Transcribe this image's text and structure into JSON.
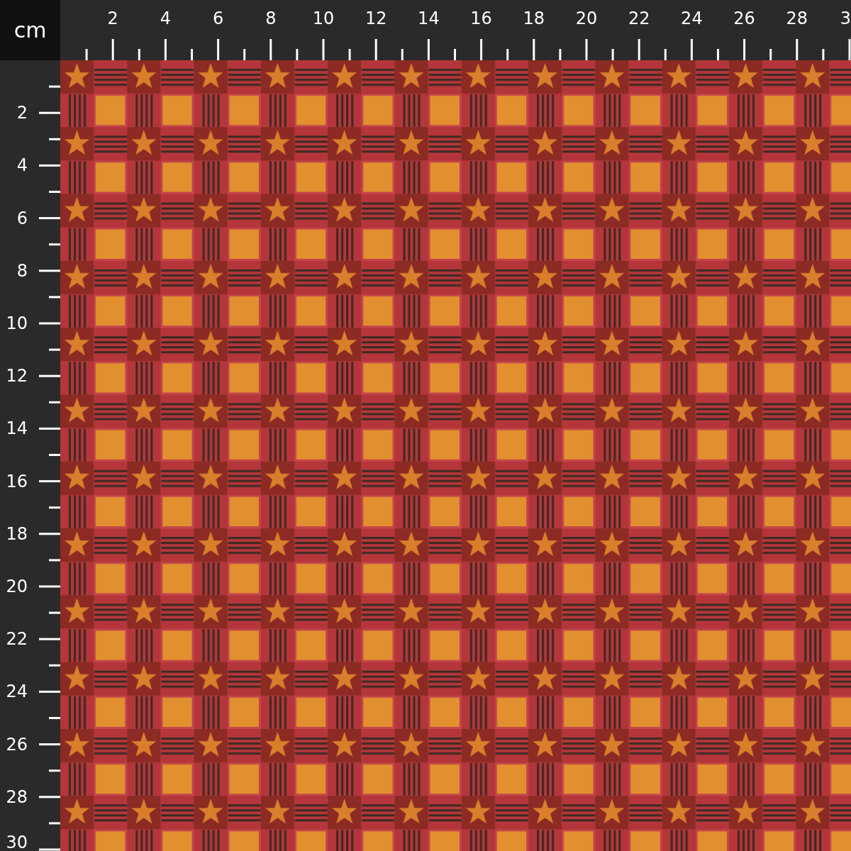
{
  "unit_label": "cm",
  "top_ruler": {
    "labels": [
      "2",
      "4",
      "6",
      "8",
      "10",
      "12",
      "14",
      "16",
      "18",
      "20",
      "22",
      "24",
      "26",
      "28",
      "3"
    ]
  },
  "left_ruler": {
    "labels": [
      "2",
      "4",
      "6",
      "8",
      "10",
      "12",
      "14",
      "16",
      "18",
      "20",
      "22",
      "24",
      "26",
      "28",
      "30"
    ]
  }
}
